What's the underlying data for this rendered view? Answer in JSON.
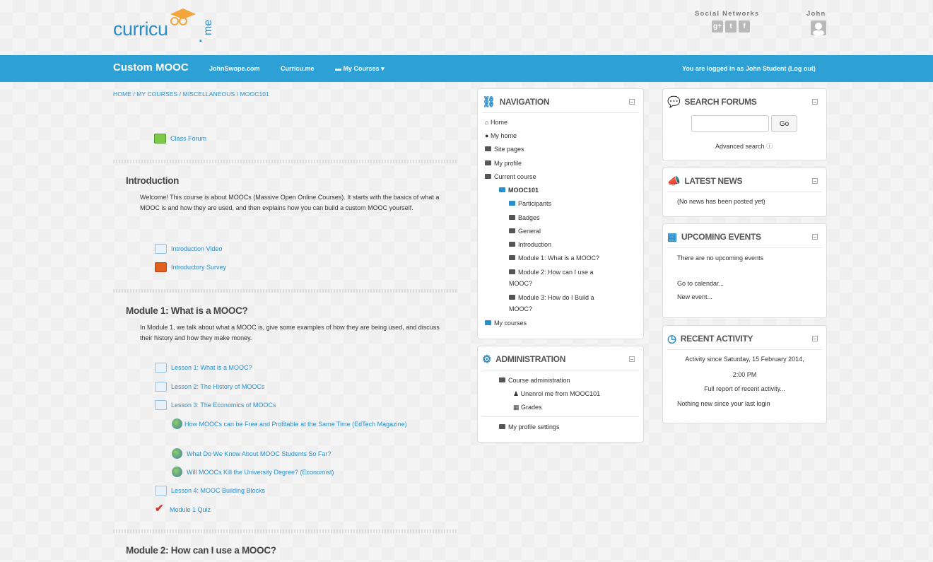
{
  "header": {
    "logo_text": "curricu",
    "logo_suffix": "me",
    "social_label": "Social Networks",
    "social_icons": [
      "google-plus-icon",
      "twitter-icon",
      "facebook-icon"
    ],
    "user_name": "John"
  },
  "navbar": {
    "brand": "Custom MOOC",
    "links": [
      "JohnSwope.com",
      "Curricu.me",
      "My Courses"
    ],
    "logged_in": "You are logged in as John Student (Log out)",
    "accent": "#2da0d5"
  },
  "breadcrumb": "HOME / MY COURSES / MISCELLANEOUS / MOOC101",
  "course": {
    "forum": "Class Forum",
    "sections": [
      {
        "title": "Introduction",
        "summary": "Welcome! This course is about MOOCs (Massive Open Online Courses). It starts with the basics of what a MOOC is and how they are used, and then explains how you can build a custom MOOC yourself.",
        "activities": [
          "Introduction Video",
          "Introductory Survey"
        ]
      },
      {
        "title": "Module 1: What is a MOOC?",
        "summary": "In Module 1, we talk about what a MOOC is, give some examples of how they are being used, and discuss their history and how they make money.",
        "activities": [
          "Lesson 1: What is a MOOC?",
          "Lesson 2: The History of MOOCs",
          "Lesson 3: The Economics of MOOCs",
          "How MOOCs can be Free and Profitable at the Same Time (EdTech Magazine)",
          "What Do We Know About MOOC Students So Far?",
          "Will MOOCs Kill the University Degree? (Economist)",
          "Lesson 4: MOOC Building Blocks",
          "Module 1 Quiz"
        ]
      },
      {
        "title": "Module 2: How can I use a MOOC?"
      }
    ]
  },
  "navigation": {
    "title": "NAVIGATION",
    "items": [
      "Home",
      "My home",
      "Site pages",
      "My profile",
      "Current course",
      "MOOC101",
      "Participants",
      "Badges",
      "General",
      "Introduction",
      "Module 1: What is a MOOC?",
      "Module 2: How can I use a",
      "MOOC?",
      "Module 3: How do I Build a",
      "MOOC?",
      "My courses"
    ]
  },
  "administration": {
    "title": "ADMINISTRATION",
    "items": [
      "Course administration",
      "Unenrol me from MOOC101",
      "Grades",
      "My profile settings"
    ]
  },
  "search_forums": {
    "title": "SEARCH FORUMS",
    "input_value": "",
    "button": "Go",
    "advanced": "Advanced search"
  },
  "latest_news": {
    "title": "LATEST NEWS",
    "text": "(No news has been posted yet)"
  },
  "upcoming_events": {
    "title": "UPCOMING EVENTS",
    "text": "There are no upcoming events",
    "links": [
      "Go to calendar...",
      "New event..."
    ]
  },
  "recent_activity": {
    "title": "RECENT ACTIVITY",
    "since_line1": "Activity since Saturday, 15 February 2014,",
    "since_line2": "2:00 PM",
    "full_report": "Full report of recent activity...",
    "nothing_new": "Nothing new since your last login"
  }
}
